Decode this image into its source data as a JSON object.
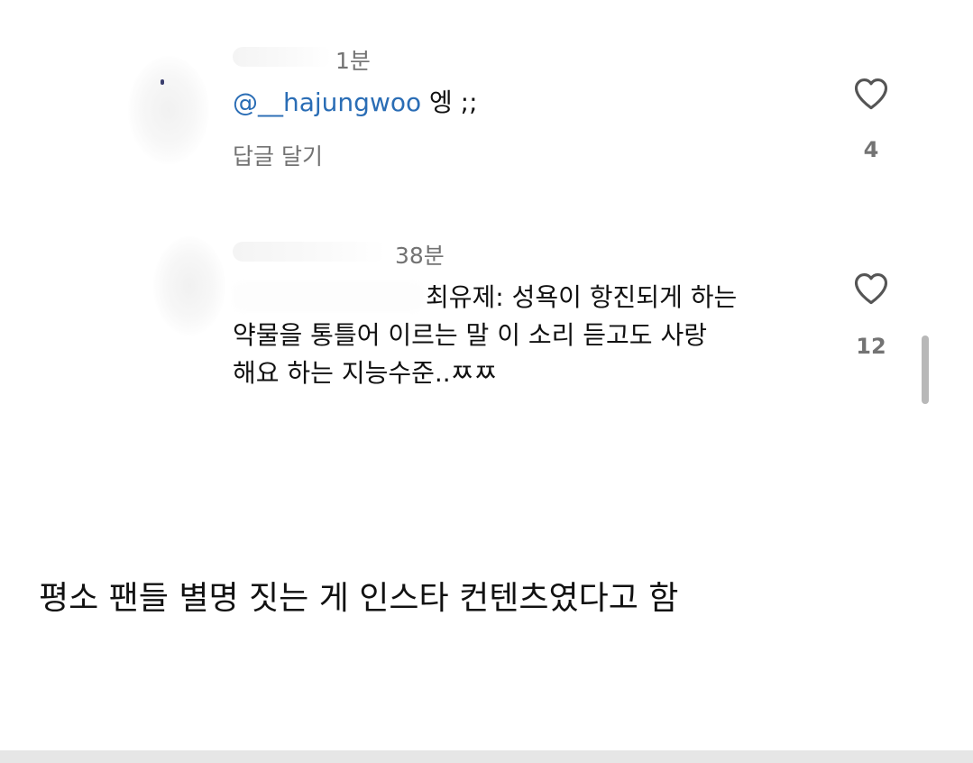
{
  "comments": [
    {
      "time": "1분",
      "mention": "@__hajungwoo",
      "text": " 엥 ;;",
      "reply_label": "답글 달기",
      "like_count": "4",
      "like_icon": "heart-outline-icon"
    },
    {
      "time": "38분",
      "lines": [
        "최유제: 성욕이 항진되게 하는",
        "약물을 통틀어 이르는 말 이 소리 듣고도 사랑",
        "해요 하는 지능수준..ㅉㅉ"
      ],
      "like_count": "12",
      "like_icon": "heart-outline-icon"
    }
  ],
  "caption": "평소 팬들 별명 짓는 게 인스타 컨텐츠였다고 함",
  "colors": {
    "mention": "#2a6db5",
    "secondary_text": "#737373",
    "primary_text": "#111111"
  }
}
